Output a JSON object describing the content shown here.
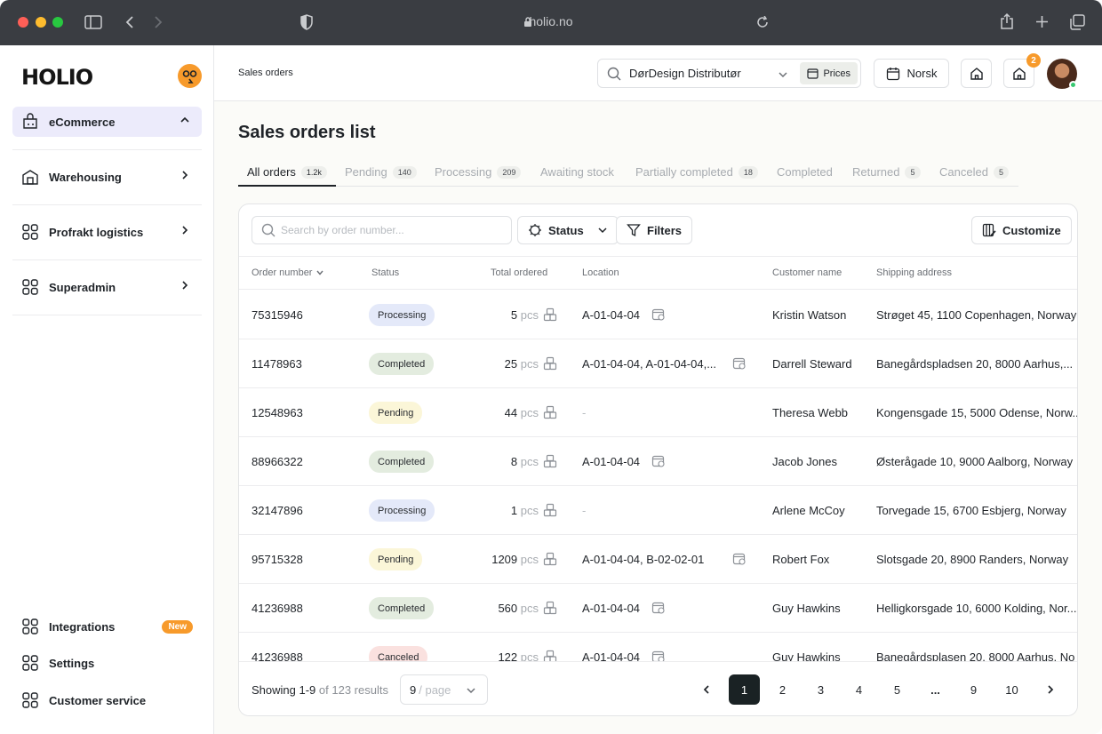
{
  "browser": {
    "url": "holio.no"
  },
  "sidebar": {
    "logo": "HOLIO",
    "items": [
      {
        "label": "eCommerce",
        "icon": "shop-icon"
      },
      {
        "label": "Warehousing",
        "icon": "warehouse-icon"
      },
      {
        "label": "Profrakt logistics",
        "icon": "grid-icon"
      },
      {
        "label": "Superadmin",
        "icon": "grid-icon"
      }
    ],
    "bottom_items": [
      {
        "label": "Integrations",
        "badge": "New"
      },
      {
        "label": "Settings"
      },
      {
        "label": "Customer service"
      }
    ]
  },
  "topbar": {
    "breadcrumb": "Sales orders",
    "distributor": "DørDesign Distributør",
    "prices_label": "Prices",
    "language": "Norsk",
    "notification_count": "2"
  },
  "page": {
    "title": "Sales orders list"
  },
  "tabs": [
    {
      "label": "All orders",
      "count": "1.2k"
    },
    {
      "label": "Pending",
      "count": "140"
    },
    {
      "label": "Processing",
      "count": "209"
    },
    {
      "label": "Awaiting stock",
      "count": ""
    },
    {
      "label": "Partially completed",
      "count": "18"
    },
    {
      "label": "Completed",
      "count": ""
    },
    {
      "label": "Returned",
      "count": "5"
    },
    {
      "label": "Canceled",
      "count": "5"
    }
  ],
  "toolbar": {
    "search_placeholder": "Search by order number...",
    "status_label": "Status",
    "filters_label": "Filters",
    "customize_label": "Customize"
  },
  "table": {
    "columns": [
      "Order number",
      "Status",
      "Total ordered",
      "Location",
      "Customer name",
      "Shipping address"
    ],
    "unit": "pcs",
    "rows": [
      {
        "order": "75315946",
        "status": "Processing",
        "qty": "5",
        "location": "A-01-04-04",
        "customer": "Kristin Watson",
        "address": "Strøget 45, 1100 Copenhagen, Norway"
      },
      {
        "order": "11478963",
        "status": "Completed",
        "qty": "25",
        "location": "A-01-04-04, A-01-04-04,...",
        "customer": "Darrell Steward",
        "address": "Banegårdspladsen 20, 8000 Aarhus,..."
      },
      {
        "order": "12548963",
        "status": "Pending",
        "qty": "44",
        "location": "-",
        "customer": "Theresa Webb",
        "address": "Kongensgade 15, 5000 Odense, Norw..."
      },
      {
        "order": "88966322",
        "status": "Completed",
        "qty": "8",
        "location": "A-01-04-04",
        "customer": "Jacob Jones",
        "address": "Østerågade 10, 9000 Aalborg, Norway"
      },
      {
        "order": "32147896",
        "status": "Processing",
        "qty": "1",
        "location": "-",
        "customer": "Arlene McCoy",
        "address": "Torvegade 15, 6700 Esbjerg, Norway"
      },
      {
        "order": "95715328",
        "status": "Pending",
        "qty": "1209",
        "location": "A-01-04-04, B-02-02-01",
        "customer": "Robert Fox",
        "address": "Slotsgade 20, 8900 Randers, Norway"
      },
      {
        "order": "41236988",
        "status": "Completed",
        "qty": "560",
        "location": "A-01-04-04",
        "customer": "Guy Hawkins",
        "address": "Helligkorsgade 10, 6000 Kolding, Nor..."
      },
      {
        "order": "41236988",
        "status": "Canceled",
        "qty": "122",
        "location": "A-01-04-04",
        "customer": "Guy Hawkins",
        "address": "Banegårdsplasen 20, 8000 Aarhus, No"
      }
    ]
  },
  "pagination": {
    "showing": "Showing 1-9",
    "of_results": "of 123 results",
    "per_page_value": "9",
    "per_page_suffix": "/ page",
    "pages": [
      "1",
      "2",
      "3",
      "4",
      "5",
      "...",
      "9",
      "10"
    ],
    "current": "1"
  },
  "colors": {
    "accent": "#f79a2b",
    "active_nav": "#ecebfb",
    "processing": "#e4e9f9",
    "completed": "#e3ecdf",
    "pending": "#fbf6d8",
    "canceled": "#fae1df"
  }
}
